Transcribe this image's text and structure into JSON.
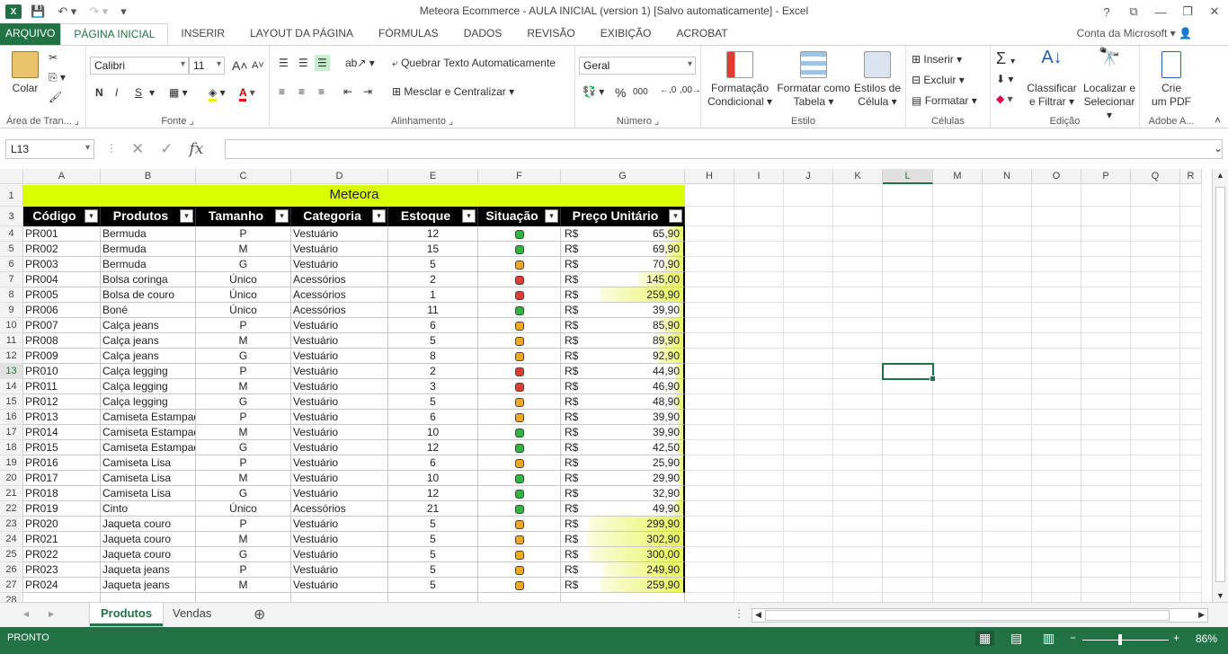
{
  "window": {
    "title": "Meteora Ecommerce - AULA INICIAL (version 1) [Salvo automaticamente] - Excel",
    "app_logo": "X"
  },
  "ribbon_tabs": [
    "ARQUIVO",
    "PÁGINA INICIAL",
    "INSERIR",
    "LAYOUT DA PÁGINA",
    "FÓRMULAS",
    "DADOS",
    "REVISÃO",
    "EXIBIÇÃO",
    "ACROBAT"
  ],
  "account": "Conta da Microsoft",
  "ribbon": {
    "clipboard": {
      "paste": "Colar",
      "label": "Área de Tran..."
    },
    "font": {
      "name": "Calibri",
      "size": "11",
      "bold": "N",
      "italic": "I",
      "underline": "S",
      "label": "Fonte",
      "grow": "A",
      "shrink": "A"
    },
    "alignment": {
      "wrap": "Quebrar Texto Automaticamente",
      "merge": "Mesclar e Centralizar",
      "label": "Alinhamento"
    },
    "number": {
      "format": "Geral",
      "percent": "%",
      "thousands": "000",
      "label": "Número"
    },
    "styles": {
      "conditional": [
        "Formatação",
        "Condicional"
      ],
      "table": [
        "Formatar como",
        "Tabela"
      ],
      "cell": [
        "Estilos de",
        "Célula"
      ],
      "label": "Estilo"
    },
    "cells": {
      "insert": "Inserir",
      "delete": "Excluir",
      "format": "Formatar",
      "label": "Células"
    },
    "editing": {
      "sort": [
        "Classificar",
        "e Filtrar"
      ],
      "find": [
        "Localizar e",
        "Selecionar"
      ],
      "label": "Edição"
    },
    "adobe": {
      "create": [
        "Crie",
        "um PDF"
      ],
      "label": "Adobe A..."
    }
  },
  "formula_bar": {
    "name_box": "L13",
    "fx": "fx",
    "value": ""
  },
  "columns": [
    "A",
    "B",
    "C",
    "D",
    "E",
    "F",
    "G",
    "H",
    "I",
    "J",
    "K",
    "L",
    "M",
    "N",
    "O",
    "P",
    "Q",
    "R"
  ],
  "selected": {
    "col": "L",
    "row": "13"
  },
  "sheet": {
    "banner": "Meteora",
    "headers": [
      "Código",
      "Produtos",
      "Tamanho",
      "Categoria",
      "Estoque",
      "Situação",
      "Preço Unitário"
    ],
    "currency": "R$",
    "rows": [
      {
        "row": "4",
        "codigo": "PR001",
        "produto": "Bermuda",
        "tamanho": "P",
        "categoria": "Vestuário",
        "estoque": "12",
        "status": "green",
        "preco": "65,90",
        "bar": 0.1
      },
      {
        "row": "5",
        "codigo": "PR002",
        "produto": "Bermuda",
        "tamanho": "M",
        "categoria": "Vestuário",
        "estoque": "15",
        "status": "green",
        "preco": "69,90",
        "bar": 0.11
      },
      {
        "row": "6",
        "codigo": "PR003",
        "produto": "Bermuda",
        "tamanho": "G",
        "categoria": "Vestuário",
        "estoque": "5",
        "status": "orange",
        "preco": "70,90",
        "bar": 0.11
      },
      {
        "row": "7",
        "codigo": "PR004",
        "produto": "Bolsa coringa",
        "tamanho": "Único",
        "categoria": "Acessórios",
        "estoque": "2",
        "status": "red",
        "preco": "145,00",
        "bar": 0.33
      },
      {
        "row": "8",
        "codigo": "PR005",
        "produto": "Bolsa de couro",
        "tamanho": "Único",
        "categoria": "Acessórios",
        "estoque": "1",
        "status": "red",
        "preco": "259,90",
        "bar": 0.64
      },
      {
        "row": "9",
        "codigo": "PR006",
        "produto": "Boné",
        "tamanho": "Único",
        "categoria": "Acessórios",
        "estoque": "11",
        "status": "green",
        "preco": "39,90",
        "bar": 0.0
      },
      {
        "row": "10",
        "codigo": "PR007",
        "produto": "Calça jeans",
        "tamanho": "P",
        "categoria": "Vestuário",
        "estoque": "6",
        "status": "orange",
        "preco": "85,90",
        "bar": 0.16
      },
      {
        "row": "11",
        "codigo": "PR008",
        "produto": "Calça jeans",
        "tamanho": "M",
        "categoria": "Vestuário",
        "estoque": "5",
        "status": "orange",
        "preco": "89,90",
        "bar": 0.17
      },
      {
        "row": "12",
        "codigo": "PR009",
        "produto": "Calça jeans",
        "tamanho": "G",
        "categoria": "Vestuário",
        "estoque": "8",
        "status": "orange",
        "preco": "92,90",
        "bar": 0.18
      },
      {
        "row": "13",
        "codigo": "PR010",
        "produto": "Calça legging",
        "tamanho": "P",
        "categoria": "Vestuário",
        "estoque": "2",
        "status": "red",
        "preco": "44,90",
        "bar": 0.02
      },
      {
        "row": "14",
        "codigo": "PR011",
        "produto": "Calça legging",
        "tamanho": "M",
        "categoria": "Vestuário",
        "estoque": "3",
        "status": "red",
        "preco": "46,90",
        "bar": 0.03
      },
      {
        "row": "15",
        "codigo": "PR012",
        "produto": "Calça legging",
        "tamanho": "G",
        "categoria": "Vestuário",
        "estoque": "5",
        "status": "orange",
        "preco": "48,90",
        "bar": 0.03
      },
      {
        "row": "16",
        "codigo": "PR013",
        "produto": "Camiseta Estampada",
        "tamanho": "P",
        "categoria": "Vestuário",
        "estoque": "6",
        "status": "orange",
        "preco": "39,90",
        "bar": 0.0
      },
      {
        "row": "17",
        "codigo": "PR014",
        "produto": "Camiseta Estampada",
        "tamanho": "M",
        "categoria": "Vestuário",
        "estoque": "10",
        "status": "green",
        "preco": "39,90",
        "bar": 0.0
      },
      {
        "row": "18",
        "codigo": "PR015",
        "produto": "Camiseta Estampada",
        "tamanho": "G",
        "categoria": "Vestuário",
        "estoque": "12",
        "status": "green",
        "preco": "42,50",
        "bar": 0.01
      },
      {
        "row": "19",
        "codigo": "PR016",
        "produto": "Camiseta Lisa",
        "tamanho": "P",
        "categoria": "Vestuário",
        "estoque": "6",
        "status": "orange",
        "preco": "25,90",
        "bar": 0.0
      },
      {
        "row": "20",
        "codigo": "PR017",
        "produto": "Camiseta Lisa",
        "tamanho": "M",
        "categoria": "Vestuário",
        "estoque": "10",
        "status": "green",
        "preco": "29,90",
        "bar": 0.0
      },
      {
        "row": "21",
        "codigo": "PR018",
        "produto": "Camiseta Lisa",
        "tamanho": "G",
        "categoria": "Vestuário",
        "estoque": "12",
        "status": "green",
        "preco": "32,90",
        "bar": 0.0
      },
      {
        "row": "22",
        "codigo": "PR019",
        "produto": "Cinto",
        "tamanho": "Único",
        "categoria": "Acessórios",
        "estoque": "21",
        "status": "green",
        "preco": "49,90",
        "bar": 0.04
      },
      {
        "row": "23",
        "codigo": "PR020",
        "produto": "Jaqueta couro",
        "tamanho": "P",
        "categoria": "Vestuário",
        "estoque": "5",
        "status": "orange",
        "preco": "299,90",
        "bar": 0.74
      },
      {
        "row": "24",
        "codigo": "PR021",
        "produto": "Jaqueta couro",
        "tamanho": "M",
        "categoria": "Vestuário",
        "estoque": "5",
        "status": "orange",
        "preco": "302,90",
        "bar": 0.75
      },
      {
        "row": "25",
        "codigo": "PR022",
        "produto": "Jaqueta couro",
        "tamanho": "G",
        "categoria": "Vestuário",
        "estoque": "5",
        "status": "orange",
        "preco": "300,00",
        "bar": 0.74
      },
      {
        "row": "26",
        "codigo": "PR023",
        "produto": "Jaqueta jeans",
        "tamanho": "P",
        "categoria": "Vestuário",
        "estoque": "5",
        "status": "orange",
        "preco": "249,90",
        "bar": 0.62
      },
      {
        "row": "27",
        "codigo": "PR024",
        "produto": "Jaqueta jeans",
        "tamanho": "M",
        "categoria": "Vestuário",
        "estoque": "5",
        "status": "orange",
        "preco": "259,90",
        "bar": 0.64
      }
    ]
  },
  "status_colors": {
    "green": "#2db83d",
    "orange": "#f5a623",
    "red": "#e03c31"
  },
  "sheets": [
    "Produtos",
    "Vendas"
  ],
  "status": {
    "ready": "PRONTO",
    "zoom": "86%"
  }
}
